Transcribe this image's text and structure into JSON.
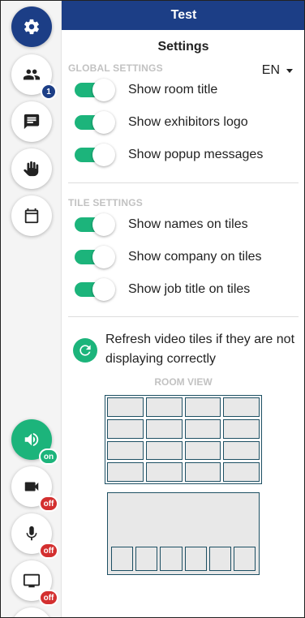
{
  "header": {
    "title": "Test"
  },
  "settings": {
    "heading": "Settings",
    "language": "EN",
    "global": {
      "label": "GLOBAL SETTINGS",
      "toggles": [
        {
          "label": "Show room title",
          "on": true
        },
        {
          "label": "Show exhibitors logo",
          "on": true
        },
        {
          "label": "Show popup messages",
          "on": true
        }
      ]
    },
    "tile": {
      "label": "TILE SETTINGS",
      "toggles": [
        {
          "label": "Show names on tiles",
          "on": true
        },
        {
          "label": "Show company on tiles",
          "on": true
        },
        {
          "label": "Show job title on tiles",
          "on": true
        }
      ]
    },
    "refresh_text": "Refresh video tiles if they are not displaying correctly",
    "room_view_label": "ROOM VIEW"
  },
  "sidebar": {
    "participants_count": "1",
    "speaker_status": "on",
    "camera_status": "off",
    "mic_status": "off",
    "screen_status": "off"
  },
  "icons": {
    "settings": "gear-icon",
    "participants": "people-icon",
    "chat": "chat-icon",
    "hand": "raise-hand-icon",
    "agenda": "calendar-icon",
    "speaker": "speaker-icon",
    "camera": "camera-icon",
    "mic": "microphone-icon",
    "screen": "screen-share-icon",
    "refresh": "refresh-icon"
  },
  "colors": {
    "brand": "#1c3e86",
    "accent_green": "#1cb47b",
    "status_red": "#d32f2f",
    "layout_border": "#1d4f63"
  }
}
